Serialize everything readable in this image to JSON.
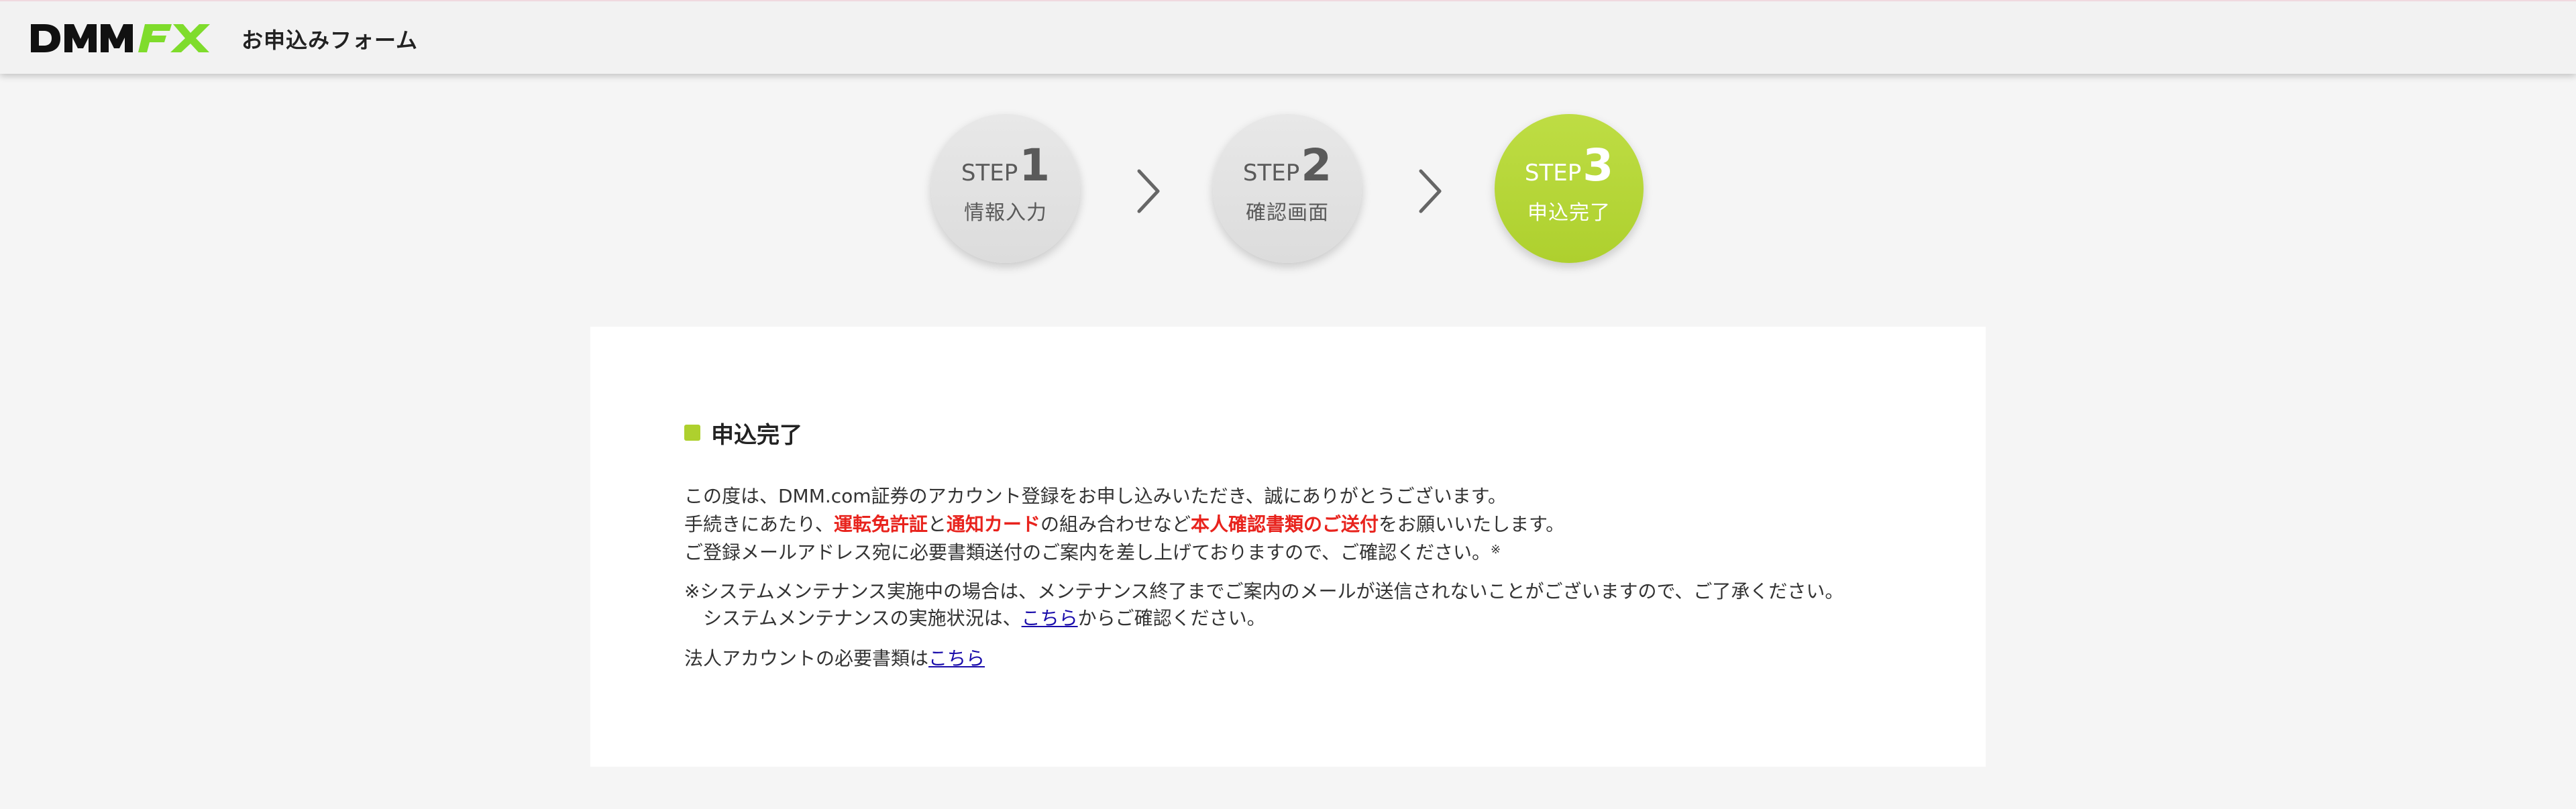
{
  "header": {
    "logo_text": "DMM FX",
    "logo_colors": {
      "dmm": "#111111",
      "fx": "#7fdc2c"
    },
    "title": "お申込みフォーム"
  },
  "steps": [
    {
      "word": "STEP",
      "number": "1",
      "label": "情報入力",
      "state": "inactive"
    },
    {
      "word": "STEP",
      "number": "2",
      "label": "確認画面",
      "state": "inactive"
    },
    {
      "word": "STEP",
      "number": "3",
      "label": "申込完了",
      "state": "active"
    }
  ],
  "step_arrow_icon": "chevron-right-icon",
  "colors": {
    "accent": "#aed02e",
    "highlight_red": "#e8231d",
    "link": "#1a0dab",
    "background": "#f5f5f5"
  },
  "card": {
    "title": "申込完了",
    "line1": "この度は、DMM.com証券のアカウント登録をお申し込みいただき、誠にありがとうございます。",
    "line2": {
      "a": "手続きにあたり、",
      "b": "運転免許証",
      "c": "と",
      "d": "通知カード",
      "e": "の組み合わせなど",
      "f": "本人確認書類のご送付",
      "g": "をお願いいたします。"
    },
    "line3": "ご登録メールアドレス宛に必要書類送付のご案内を差し上げておりますので、ご確認ください。",
    "line3_mark": "※",
    "note1": "※システムメンテナンス実施中の場合は、メンテナンス終了までご案内のメールが送信されないことがございますので、ご了承ください。",
    "note2": {
      "prefix": "　システムメンテナンスの実施状況は、",
      "link": "こちら",
      "suffix": "からご確認ください。"
    },
    "corp": {
      "prefix": "法人アカウントの必要書類は",
      "link": "こちら"
    }
  }
}
